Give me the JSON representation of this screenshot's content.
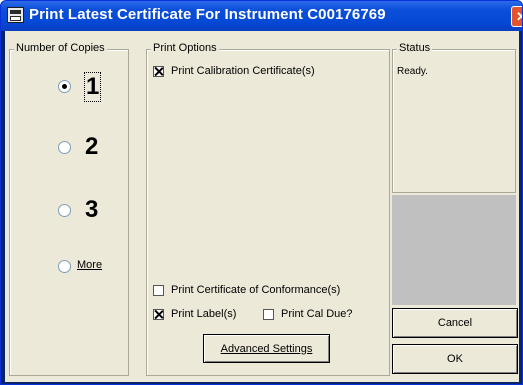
{
  "window": {
    "title": "Print Latest Certificate For Instrument C00176769",
    "close_label": "✕"
  },
  "copies": {
    "legend": "Number of Copies",
    "options": [
      "1",
      "2",
      "3",
      "More"
    ],
    "selected": "1"
  },
  "print_options": {
    "legend": "Print Options",
    "calibration_certificate": {
      "label": "Print Calibration Certificate(s)",
      "checked": true
    },
    "certificate_of_conformance": {
      "label": "Print Certificate of Conformance(s)",
      "checked": false
    },
    "labels": {
      "label": "Print Label(s)",
      "checked": true
    },
    "cal_due": {
      "label": "Print Cal Due?",
      "checked": false
    },
    "advanced_button": "Advanced Settings"
  },
  "status": {
    "legend": "Status",
    "text": "Ready."
  },
  "buttons": {
    "cancel": "Cancel",
    "ok": "OK"
  }
}
